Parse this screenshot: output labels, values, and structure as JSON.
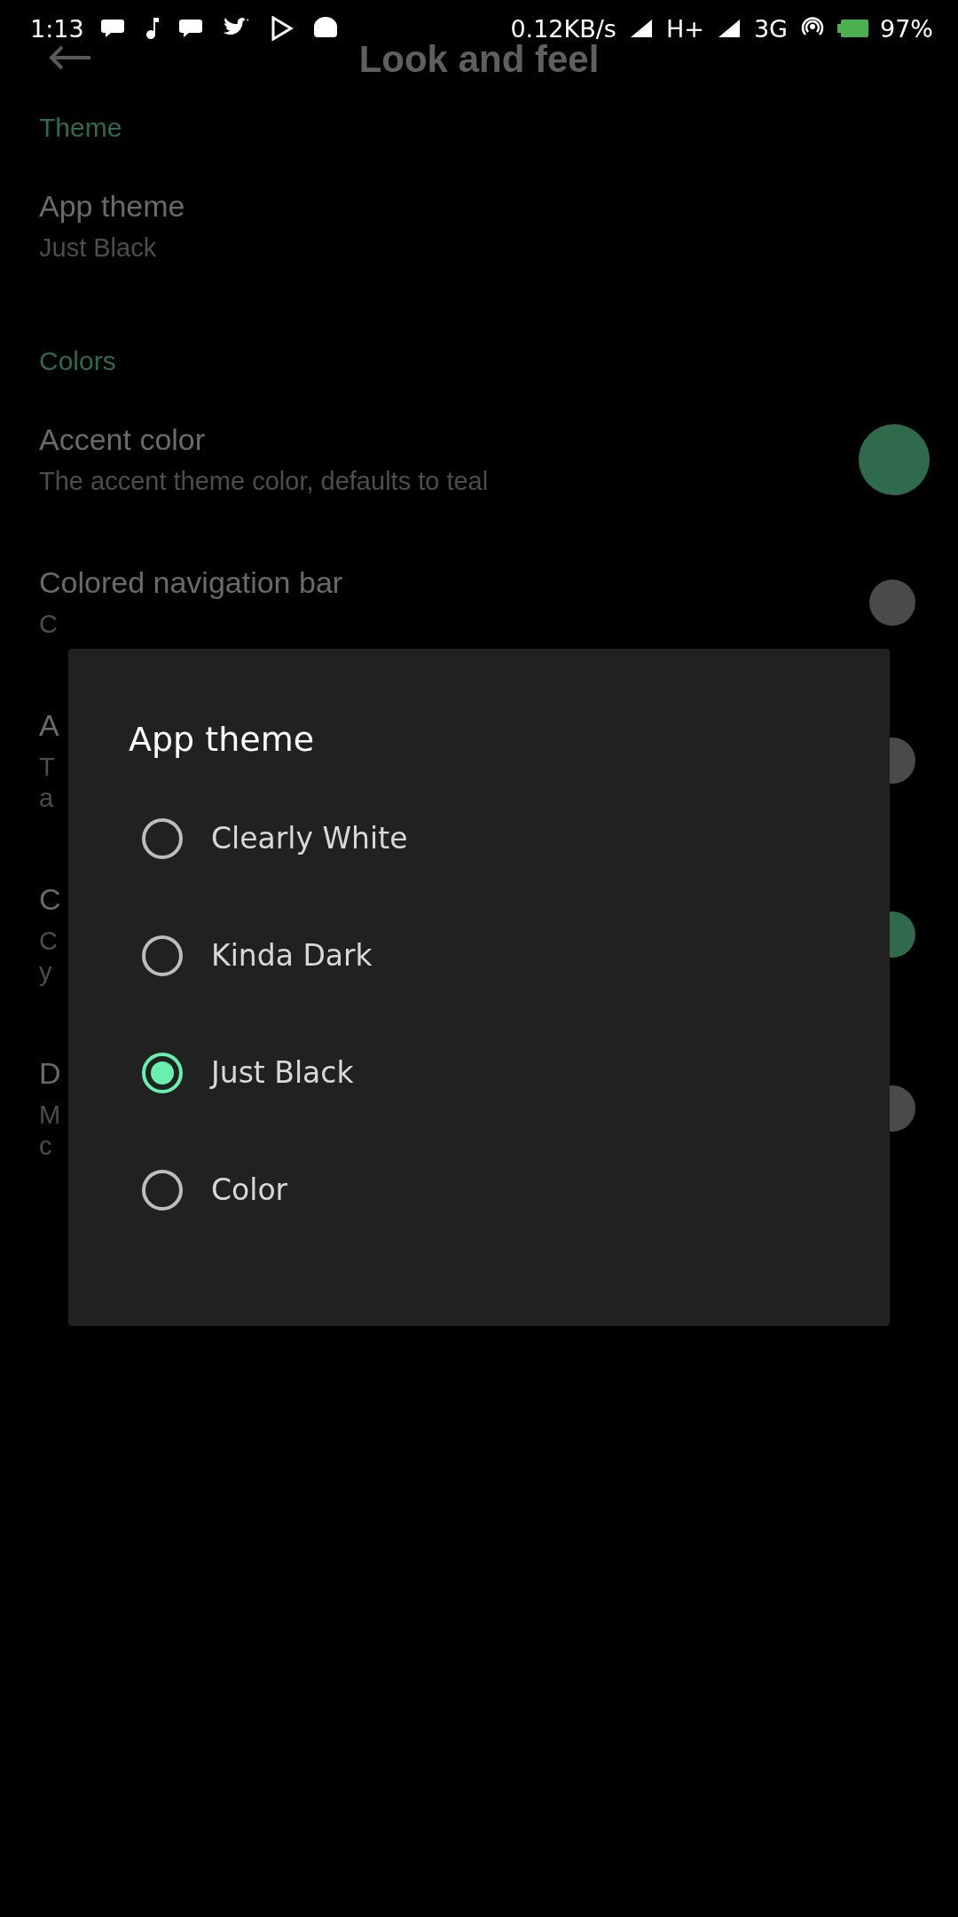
{
  "status_bar": {
    "time": "1:13",
    "speed": "0.12KB/s",
    "network_1": "H+",
    "network_2": "3G",
    "battery": "97%"
  },
  "app_bar": {
    "title": "Look and feel"
  },
  "sections": [
    {
      "header": "Theme",
      "items": [
        {
          "kind": "plain",
          "title": "App theme",
          "subtitle_lines": [
            "Just Black"
          ]
        }
      ]
    },
    {
      "header": "Colors",
      "items": [
        {
          "kind": "color",
          "title": "Accent color",
          "subtitle_lines": [
            "The accent theme color, defaults to teal"
          ],
          "color": "#2f6a4c"
        },
        {
          "kind": "switch",
          "title": "Colored navigation bar",
          "subtitle_lines": [
            "C"
          ],
          "on": false
        },
        {
          "kind": "switch",
          "title": "A",
          "subtitle_lines": [
            "T",
            "a"
          ],
          "on": false
        },
        {
          "kind": "switch",
          "title": "C",
          "subtitle_lines": [
            "C",
            "y"
          ],
          "on": true
        },
        {
          "kind": "switch",
          "title": "D",
          "subtitle_lines": [
            "M",
            "c"
          ],
          "on": false
        }
      ]
    }
  ],
  "dialog": {
    "title": "App theme",
    "options": [
      {
        "label": "Clearly White",
        "selected": false
      },
      {
        "label": "Kinda Dark",
        "selected": false
      },
      {
        "label": "Just Black",
        "selected": true
      },
      {
        "label": "Color",
        "selected": false
      }
    ]
  }
}
